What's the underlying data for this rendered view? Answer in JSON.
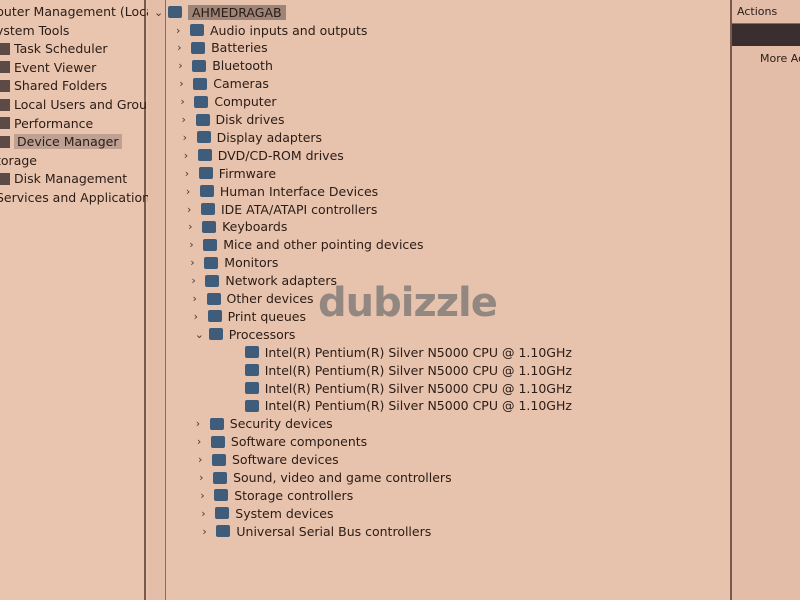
{
  "left_nav": {
    "items": [
      {
        "label": "puter Management (Local",
        "icon": "computer-management-icon",
        "level": 0
      },
      {
        "label": "ystem Tools",
        "icon": "tools-icon",
        "level": 0
      },
      {
        "label": "Task Scheduler",
        "icon": "clock-icon",
        "level": 1
      },
      {
        "label": "Event Viewer",
        "icon": "event-viewer-icon",
        "level": 1
      },
      {
        "label": "Shared Folders",
        "icon": "folder-icon",
        "level": 1
      },
      {
        "label": "Local Users and Groups",
        "icon": "users-icon",
        "level": 1
      },
      {
        "label": "Performance",
        "icon": "performance-icon",
        "level": 1
      },
      {
        "label": "Device Manager",
        "icon": "device-manager-icon",
        "level": 1,
        "selected": true
      },
      {
        "label": "torage",
        "icon": "storage-icon",
        "level": 0
      },
      {
        "label": "Disk Management",
        "icon": "disk-icon",
        "level": 1
      },
      {
        "label": "Services and Applications",
        "icon": "services-icon",
        "level": 0
      }
    ]
  },
  "tree": {
    "root": "AHMEDRAGAB",
    "categories": [
      {
        "label": "Audio inputs and outputs",
        "icon": "speaker-icon"
      },
      {
        "label": "Batteries",
        "icon": "battery-icon"
      },
      {
        "label": "Bluetooth",
        "icon": "bluetooth-icon"
      },
      {
        "label": "Cameras",
        "icon": "camera-icon"
      },
      {
        "label": "Computer",
        "icon": "monitor-icon"
      },
      {
        "label": "Disk drives",
        "icon": "disk-drive-icon"
      },
      {
        "label": "Display adapters",
        "icon": "display-adapter-icon"
      },
      {
        "label": "DVD/CD-ROM drives",
        "icon": "dvd-icon"
      },
      {
        "label": "Firmware",
        "icon": "firmware-icon"
      },
      {
        "label": "Human Interface Devices",
        "icon": "hid-icon"
      },
      {
        "label": "IDE ATA/ATAPI controllers",
        "icon": "ide-icon"
      },
      {
        "label": "Keyboards",
        "icon": "keyboard-icon"
      },
      {
        "label": "Mice and other pointing devices",
        "icon": "mouse-icon"
      },
      {
        "label": "Monitors",
        "icon": "monitor-icon"
      },
      {
        "label": "Network adapters",
        "icon": "network-icon"
      },
      {
        "label": "Other devices",
        "icon": "unknown-device-icon"
      },
      {
        "label": "Print queues",
        "icon": "printer-icon"
      },
      {
        "label": "Processors",
        "icon": "processor-icon",
        "expanded": true,
        "children": [
          "Intel(R) Pentium(R) Silver N5000 CPU @ 1.10GHz",
          "Intel(R) Pentium(R) Silver N5000 CPU @ 1.10GHz",
          "Intel(R) Pentium(R) Silver N5000 CPU @ 1.10GHz",
          "Intel(R) Pentium(R) Silver N5000 CPU @ 1.10GHz"
        ]
      },
      {
        "label": "Security devices",
        "icon": "security-icon"
      },
      {
        "label": "Software components",
        "icon": "software-component-icon"
      },
      {
        "label": "Software devices",
        "icon": "software-device-icon"
      },
      {
        "label": "Sound, video and game controllers",
        "icon": "sound-icon"
      },
      {
        "label": "Storage controllers",
        "icon": "storage-controller-icon"
      },
      {
        "label": "System devices",
        "icon": "system-icon"
      },
      {
        "label": "Universal Serial Bus controllers",
        "icon": "usb-icon"
      }
    ]
  },
  "actions": {
    "title": "Actions",
    "more": "More Ac"
  },
  "watermark": "dubizzle"
}
